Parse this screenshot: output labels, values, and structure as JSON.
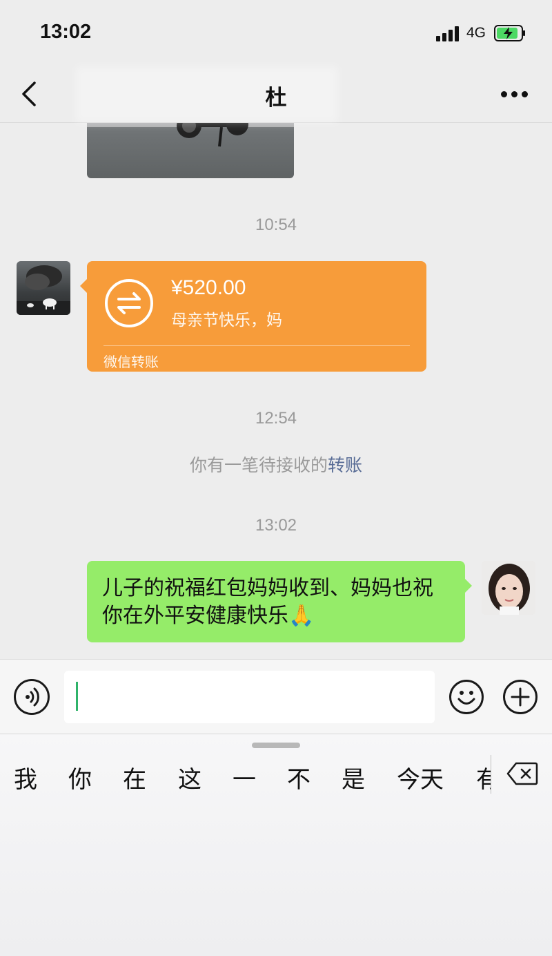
{
  "status_bar": {
    "time": "13:02",
    "network": "4G"
  },
  "nav": {
    "title": "杜"
  },
  "chat": {
    "timestamps": [
      "10:54",
      "12:54",
      "13:02"
    ],
    "transfer": {
      "amount": "¥520.00",
      "note": "母亲节快乐，妈",
      "label": "微信转账"
    },
    "system_message": {
      "text": "你有一笔待接收的",
      "link": "转账"
    },
    "outgoing_message": "儿子的祝福红包妈妈收到、妈妈也祝你在外平安健康快乐🙏"
  },
  "keyboard": {
    "candidates": [
      "我",
      "你",
      "在",
      "这",
      "一",
      "不",
      "是",
      "今天",
      "有"
    ]
  },
  "colors": {
    "background": "#ededed",
    "transfer_card": "#f79c3a",
    "outgoing_bubble": "#95ec69",
    "link": "#576b95",
    "caret": "#2fb36a"
  }
}
